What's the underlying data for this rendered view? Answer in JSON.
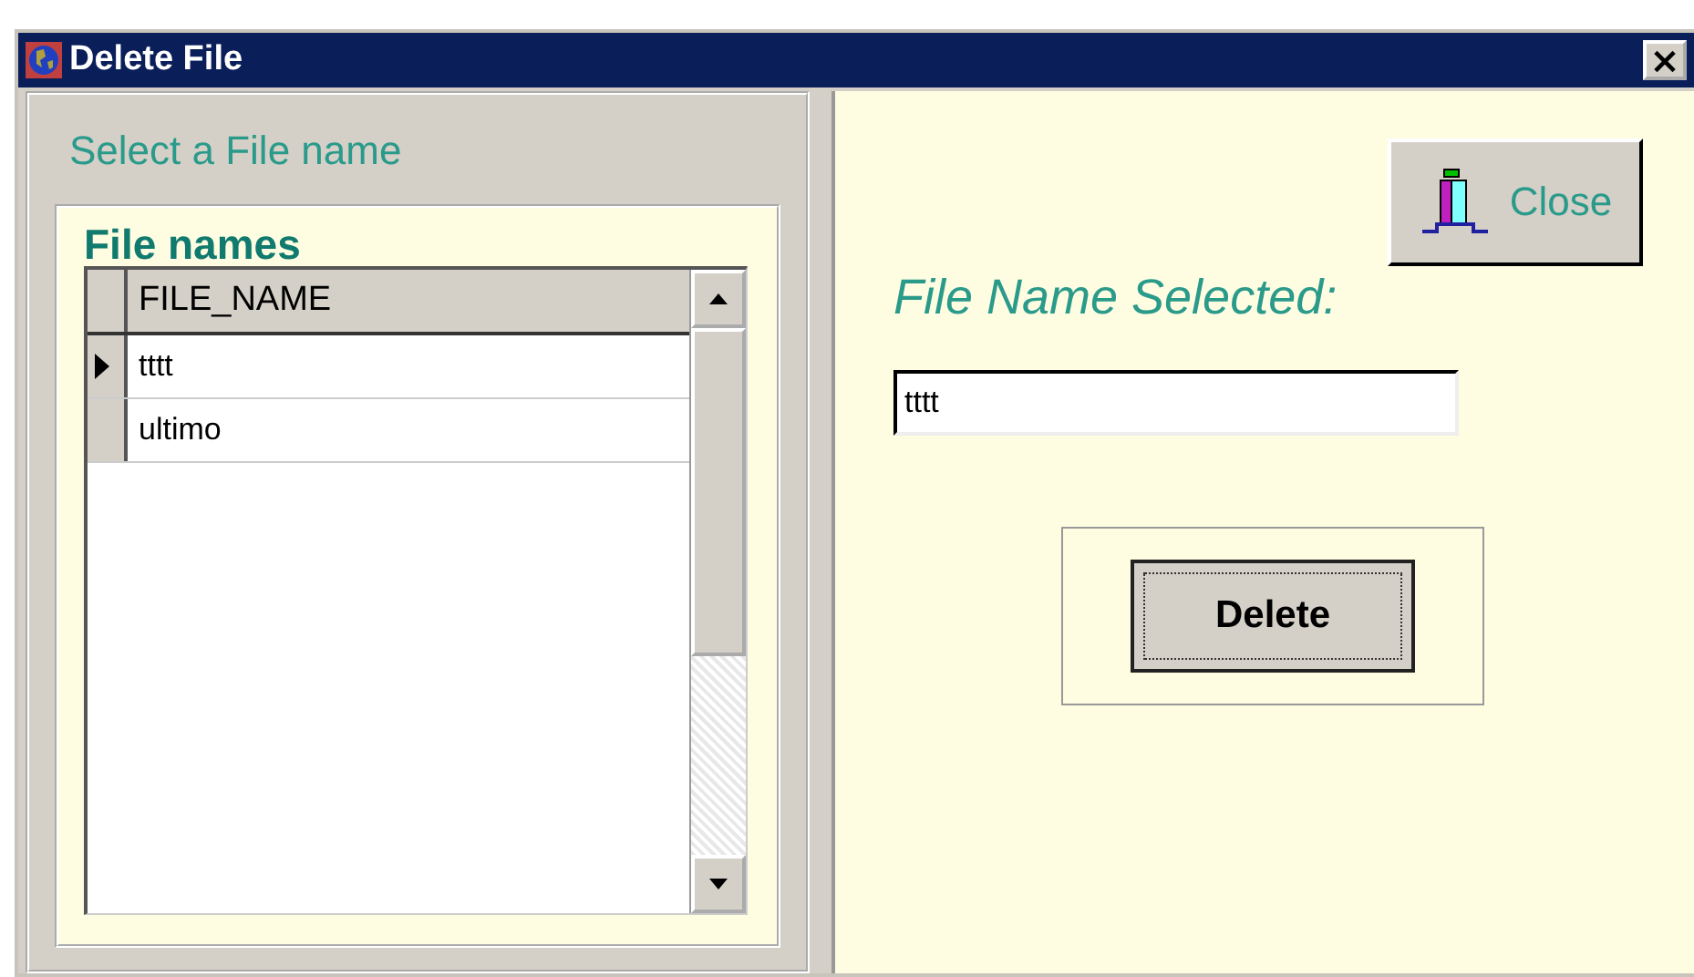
{
  "window": {
    "title": "Delete File",
    "close": "×"
  },
  "left_panel": {
    "title": "Select a File name",
    "group_title": "File names",
    "table": {
      "columns": [
        "FILE_NAME"
      ],
      "rows": [
        {
          "cells": [
            "tttt"
          ],
          "selected": true
        },
        {
          "cells": [
            "ultimo"
          ],
          "selected": false
        }
      ]
    }
  },
  "right_panel": {
    "close_button": "Close",
    "selected_label": "File Name Selected:",
    "selected_value": "tttt",
    "delete_button": "Delete"
  }
}
